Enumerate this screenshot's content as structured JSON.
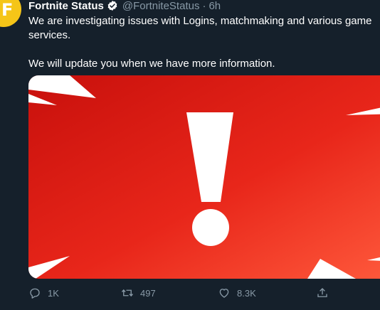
{
  "tweet": {
    "avatar_letter": "F",
    "display_name": "Fortnite Status",
    "handle": "@FortniteStatus",
    "separator": "·",
    "time": "6h",
    "text_line1": "We are investigating issues with Logins, matchmaking and various game services.",
    "text_line2": "We will update you when we have more information."
  },
  "media": {
    "icon": "exclamation-alert",
    "gradient_start": "#c8100c",
    "gradient_end": "#ff5a3c"
  },
  "actions": {
    "reply_count": "1K",
    "retweet_count": "497",
    "like_count": "8.3K"
  },
  "colors": {
    "background": "#15202b",
    "text": "#ffffff",
    "secondary": "#8899a6",
    "verified": "#ffffff",
    "avatar": "#f5c518"
  }
}
